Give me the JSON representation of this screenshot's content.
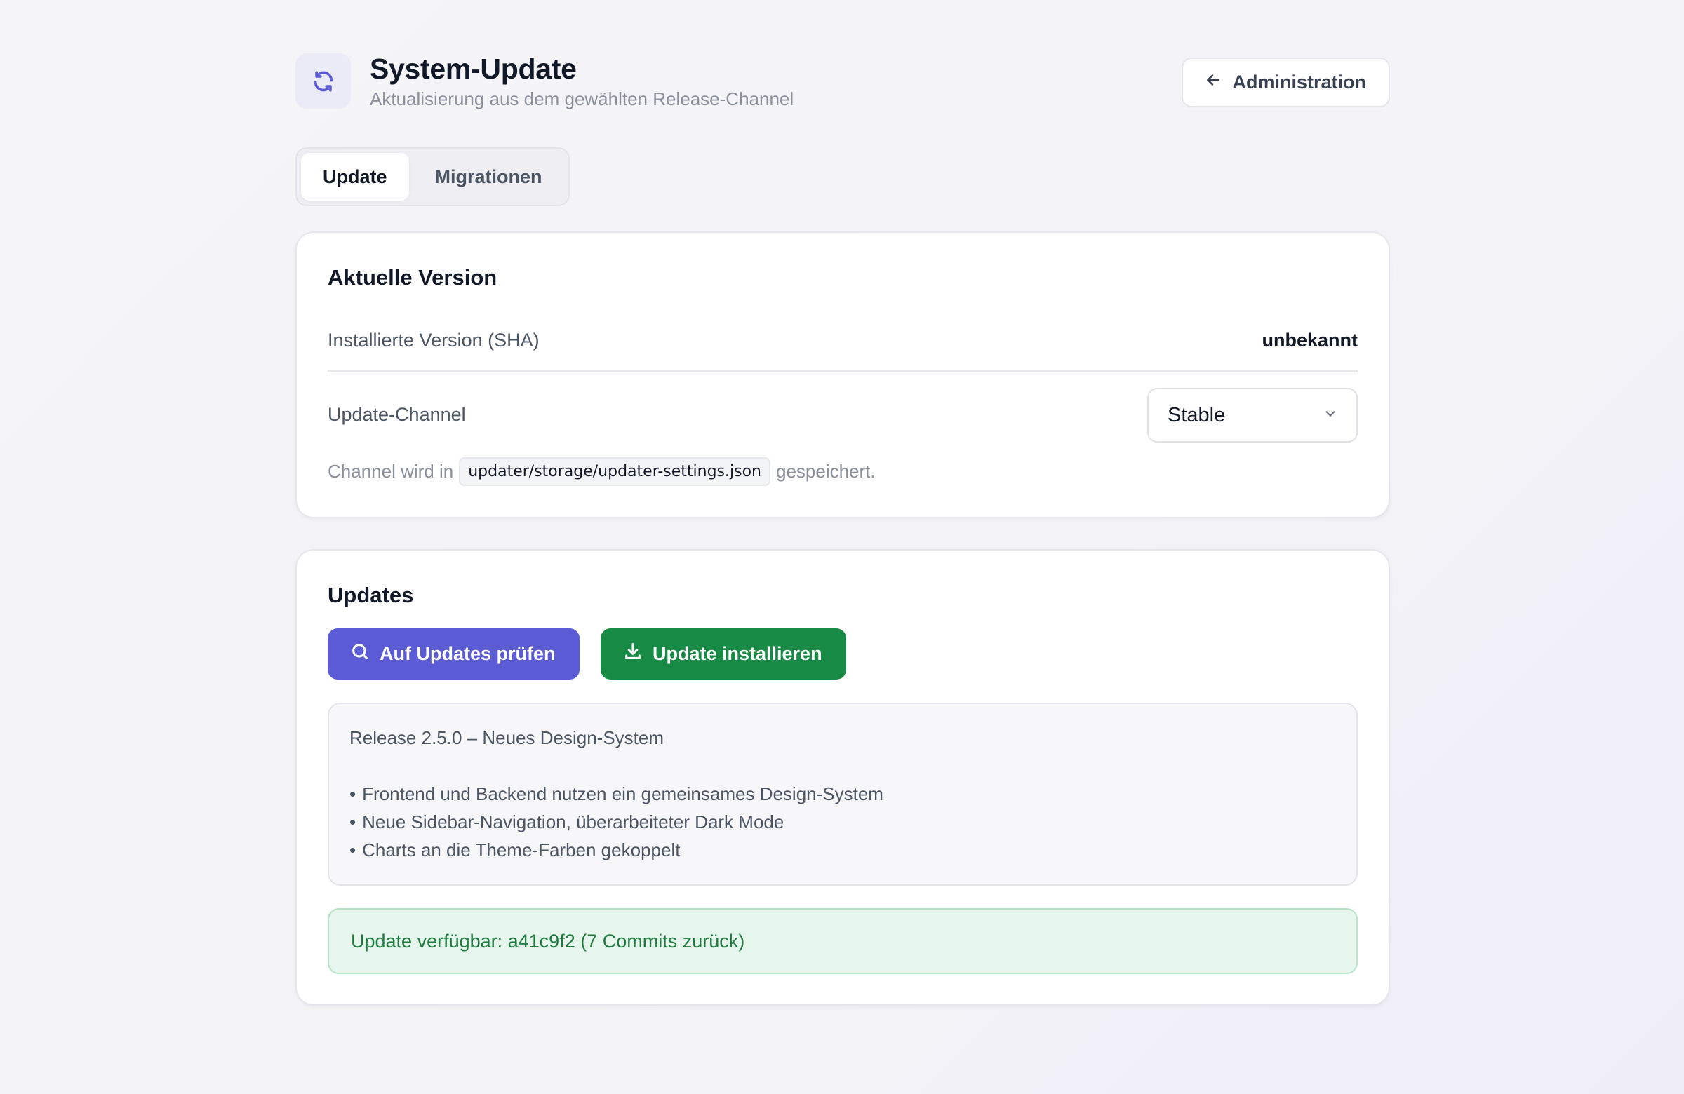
{
  "header": {
    "title": "System-Update",
    "subtitle": "Aktualisierung aus dem gewählten Release-Channel",
    "back_label": "Administration",
    "icon": "refresh-icon"
  },
  "tabs": [
    {
      "label": "Update",
      "active": true
    },
    {
      "label": "Migrationen",
      "active": false
    }
  ],
  "version_card": {
    "title": "Aktuelle Version",
    "installed_label": "Installierte Version (SHA)",
    "installed_value": "unbekannt",
    "channel_label": "Update-Channel",
    "channel_value": "Stable",
    "hint_prefix": "Channel wird in",
    "hint_path": "updater/storage/updater-settings.json",
    "hint_suffix": "gespeichert."
  },
  "updates_card": {
    "title": "Updates",
    "check_label": "Auf Updates prüfen",
    "install_label": "Update installieren",
    "release_title": "Release 2.5.0 – Neues Design-System",
    "release_notes": [
      "Frontend und Backend nutzen ein gemeinsames Design-System",
      "Neue Sidebar-Navigation, überarbeiteter Dark Mode",
      "Charts an die Theme-Farben gekoppelt"
    ],
    "status": "Update verfügbar: a41c9f2 (7 Commits zurück)"
  },
  "colors": {
    "primary": "#5b5bd6",
    "success": "#178a45",
    "success_bg": "#e7f6ec",
    "success_text": "#1f7a3f"
  }
}
